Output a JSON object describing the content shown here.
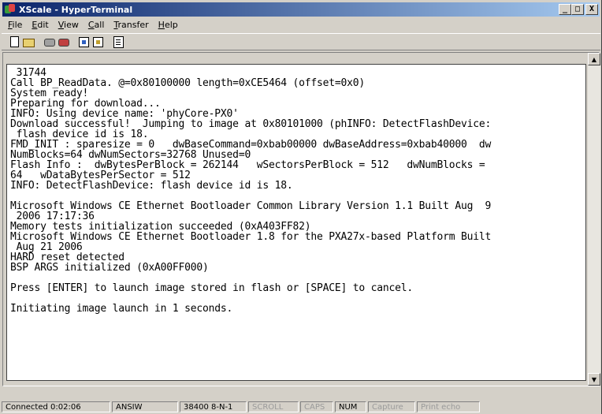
{
  "window": {
    "title": "XScale - HyperTerminal",
    "caption_buttons": [
      "_",
      "□",
      "X"
    ]
  },
  "menu": {
    "items": [
      "File",
      "Edit",
      "View",
      "Call",
      "Transfer",
      "Help"
    ],
    "accelerators": [
      "F",
      "E",
      "V",
      "C",
      "T",
      "H"
    ]
  },
  "toolbar": {
    "icons": [
      "new-connection-icon",
      "open-icon",
      "connect-icon",
      "disconnect-icon",
      "send-file-icon",
      "receive-file-icon",
      "properties-icon"
    ]
  },
  "terminal": {
    "lines": [
      " 31744",
      "Call BP_ReadData. @=0x80100000 length=0xCE5464 (offset=0x0)",
      "System ready!",
      "Preparing for download...",
      "INFO: Using device name: 'phyCore-PX0'",
      "Download successful!  Jumping to image at 0x80101000 (phINFO: DetectFlashDevice:",
      " flash device id is 18.",
      "FMD_INIT : sparesize = 0   dwBaseCommand=0xbab00000 dwBaseAddress=0xbab40000  dw",
      "NumBlocks=64 dwNumSectors=32768 Unused=0",
      "Flash Info :  dwBytesPerBlock = 262144   wSectorsPerBlock = 512   dwNumBlocks =",
      "64   wDataBytesPerSector = 512",
      "INFO: DetectFlashDevice: flash device id is 18.",
      "",
      "Microsoft Windows CE Ethernet Bootloader Common Library Version 1.1 Built Aug  9",
      " 2006 17:17:36",
      "Memory tests initialization succeeded (0xA403FF82)",
      "Microsoft Windows CE Ethernet Bootloader 1.8 for the PXA27x-based Platform Built",
      " Aug 21 2006",
      "HARD reset detected",
      "BSP ARGS initialized (0xA00FF000)",
      "",
      "Press [ENTER] to launch image stored in flash or [SPACE] to cancel.",
      "",
      "Initiating image launch in 1 seconds."
    ]
  },
  "statusbar": {
    "connected": "Connected 0:02:06",
    "emulation": "ANSIW",
    "port_settings": "38400 8-N-1",
    "scroll": "SCROLL",
    "caps": "CAPS",
    "num": "NUM",
    "capture": "Capture",
    "print_echo": "Print echo"
  }
}
